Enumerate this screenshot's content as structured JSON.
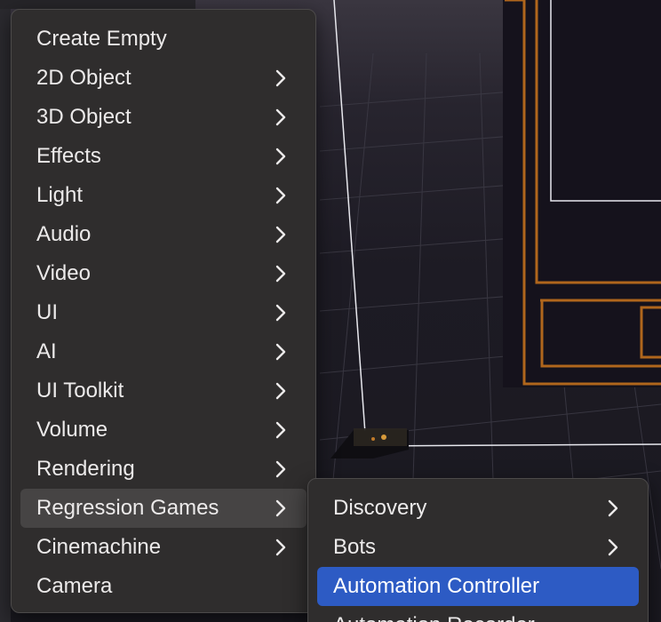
{
  "context_menu": {
    "items": [
      {
        "label": "Create Empty",
        "submenu": false
      },
      {
        "label": "2D Object",
        "submenu": true
      },
      {
        "label": "3D Object",
        "submenu": true
      },
      {
        "label": "Effects",
        "submenu": true
      },
      {
        "label": "Light",
        "submenu": true
      },
      {
        "label": "Audio",
        "submenu": true
      },
      {
        "label": "Video",
        "submenu": true
      },
      {
        "label": "UI",
        "submenu": true
      },
      {
        "label": "AI",
        "submenu": true
      },
      {
        "label": "UI Toolkit",
        "submenu": true
      },
      {
        "label": "Volume",
        "submenu": true
      },
      {
        "label": "Rendering",
        "submenu": true
      },
      {
        "label": "Regression Games",
        "submenu": true,
        "state": "open"
      },
      {
        "label": "Cinemachine",
        "submenu": true
      },
      {
        "label": "Camera",
        "submenu": false
      }
    ]
  },
  "submenu": {
    "items": [
      {
        "label": "Discovery",
        "submenu": true
      },
      {
        "label": "Bots",
        "submenu": true
      },
      {
        "label": "Automation Controller",
        "submenu": false,
        "state": "highlighted"
      },
      {
        "label": "Automation Recorder",
        "submenu": false
      }
    ]
  },
  "icons": {
    "submenu_indicator": "chevron-right-icon"
  },
  "colors": {
    "menu_background": "#2f2d2d",
    "highlight": "#2d5bc4",
    "hover": "#464444",
    "text": "#eceaea",
    "scene_outline": "#b0661c"
  }
}
